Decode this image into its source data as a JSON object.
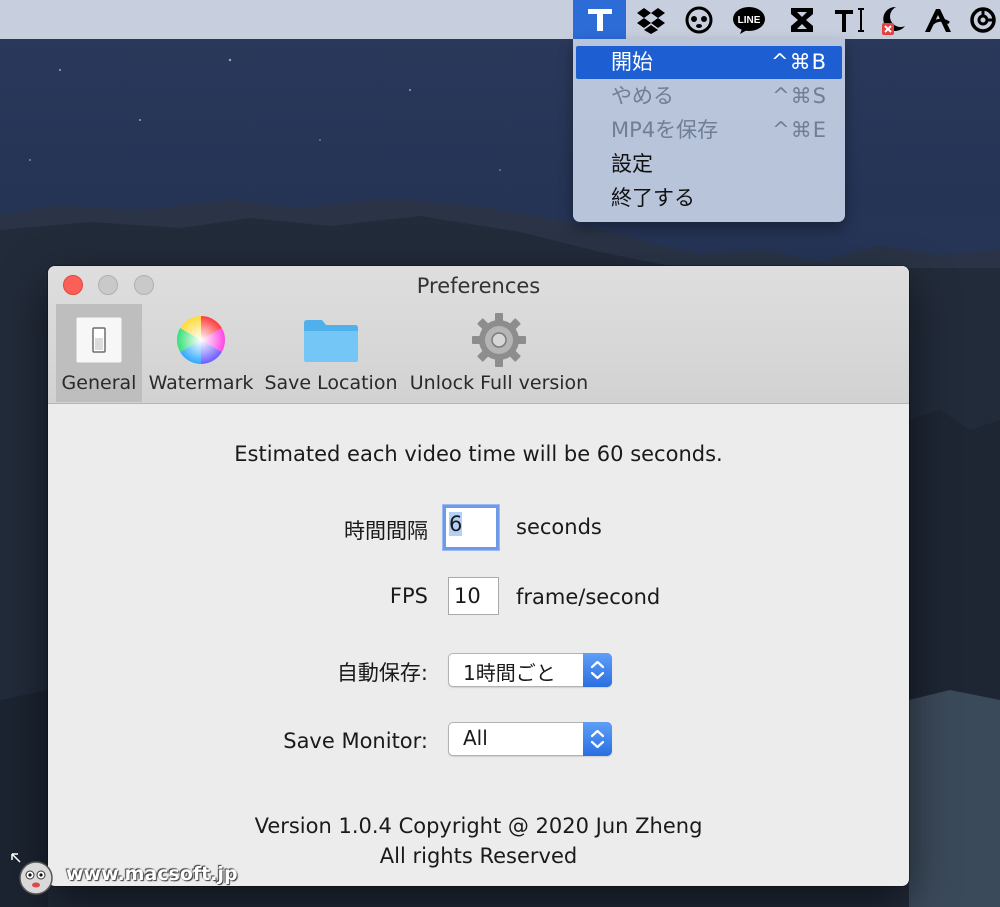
{
  "menubar": {
    "icons": [
      "t-app-icon",
      "dropbox-icon",
      "panda-icon",
      "line-icon",
      "hourglass-icon",
      "text-cursor-icon",
      "moon-badge-icon",
      "a-app-icon",
      "knot-icon"
    ],
    "line_label": "LINE"
  },
  "dropdown": {
    "items": [
      {
        "label": "開始",
        "shortcut": "^⌘B"
      },
      {
        "label": "やめる",
        "shortcut": "^⌘S"
      },
      {
        "label": "MP4を保存",
        "shortcut": "^⌘E"
      },
      {
        "label": "設定",
        "shortcut": ""
      },
      {
        "label": "終了する",
        "shortcut": ""
      }
    ]
  },
  "window": {
    "title": "Preferences",
    "toolbar": {
      "general": "General",
      "watermark": "Watermark",
      "save_location": "Save Location",
      "unlock": "Unlock Full version"
    },
    "estimate": "Estimated each video time will be 60 seconds.",
    "interval": {
      "label": "時間間隔",
      "value": "6",
      "unit": "seconds"
    },
    "fps": {
      "label": "FPS",
      "value": "10",
      "unit": "frame/second"
    },
    "autosave": {
      "label": "自動保存:",
      "value": "1時間ごと"
    },
    "monitor": {
      "label": "Save Monitor:",
      "value": "All"
    },
    "footer": {
      "version": "Version 1.0.4 Copyright @ 2020 Jun Zheng",
      "rights": "All rights Reserved"
    }
  },
  "watermark": {
    "text": "www.macsoft.jp"
  },
  "colors": {
    "accent": "#1d5fd3",
    "close": "#fc5f57",
    "menubar": "#c7cfdf"
  }
}
